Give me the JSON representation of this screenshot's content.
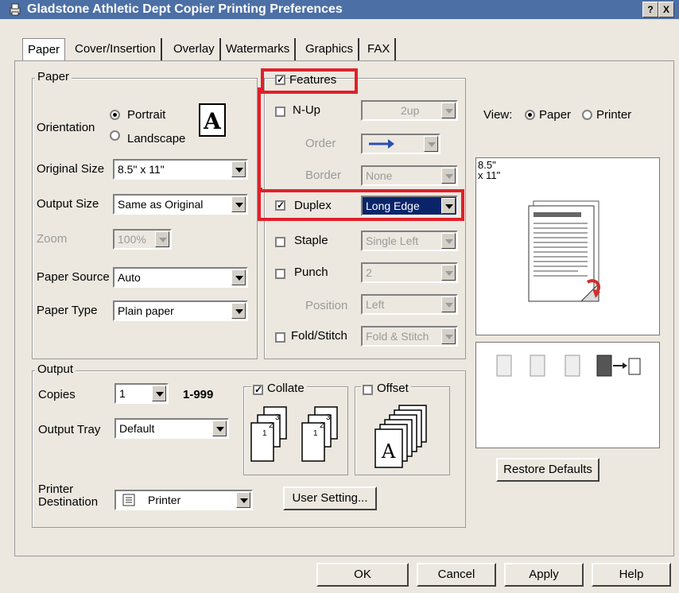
{
  "window": {
    "title": "Gladstone Athletic Dept Copier Printing Preferences",
    "help_button": "?",
    "close_button": "X"
  },
  "tabs": [
    "Paper",
    "Cover/Insertion",
    "Overlay",
    "Watermarks",
    "Graphics",
    "FAX"
  ],
  "paper_group": {
    "legend": "Paper",
    "orientation_label": "Orientation",
    "portrait": "Portrait",
    "landscape": "Landscape",
    "orientation_icon": "A",
    "original_size_label": "Original Size",
    "original_size_value": "8.5\" x 11\"",
    "output_size_label": "Output Size",
    "output_size_value": "Same as Original",
    "zoom_label": "Zoom",
    "zoom_value": "100%",
    "paper_source_label": "Paper Source",
    "paper_source_value": "Auto",
    "paper_type_label": "Paper Type",
    "paper_type_value": "Plain paper"
  },
  "features": {
    "label": "Features",
    "nup_label": "N-Up",
    "nup_value": "2up",
    "order_label": "Order",
    "border_label": "Border",
    "border_value": "None",
    "duplex_label": "Duplex",
    "duplex_value": "Long Edge",
    "staple_label": "Staple",
    "staple_value": "Single Left",
    "punch_label": "Punch",
    "punch_value": "2",
    "position_label": "Position",
    "position_value": "Left",
    "fold_label": "Fold/Stitch",
    "fold_value": "Fold & Stitch"
  },
  "view": {
    "label": "View:",
    "paper": "Paper",
    "printer": "Printer",
    "size_line1": "8.5\"",
    "size_line2": "x 11\""
  },
  "output_group": {
    "legend": "Output",
    "copies_label": "Copies",
    "copies_value": "1",
    "copies_range": "1-999",
    "collate_label": "Collate",
    "offset_label": "Offset",
    "output_tray_label": "Output Tray",
    "output_tray_value": "Default",
    "printer_destination_label_1": "Printer",
    "printer_destination_label_2": "Destination",
    "printer_destination_value": "Printer",
    "user_setting_button": "User Setting...",
    "collate_page_1": "1",
    "collate_page_2": "2",
    "collate_page_3": "3",
    "offset_icon": "A"
  },
  "restore_defaults_button": "Restore Defaults",
  "footer": {
    "ok": "OK",
    "cancel": "Cancel",
    "apply": "Apply",
    "help": "Help"
  },
  "colors": {
    "titlebar": "#4c6fa6",
    "highlight_box": "#e0202a",
    "selection": "#0a246a"
  }
}
